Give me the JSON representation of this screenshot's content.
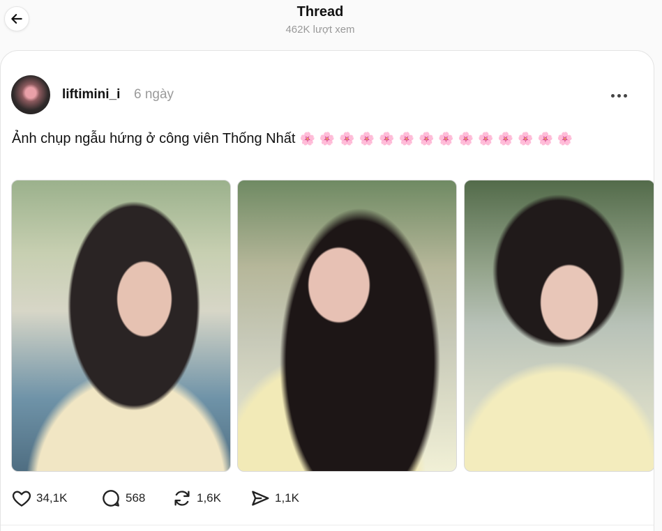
{
  "header": {
    "title": "Thread",
    "views": "462K lượt xem",
    "back_icon": "arrow-left-icon"
  },
  "post": {
    "username": "liftimini_i",
    "time": "6 ngày",
    "caption": "Ảnh chụp ngẫu hứng ở công viên Thống Nhất",
    "flower_count": 14,
    "flower_glyph": "🌸",
    "flower_color": "#f06f9a",
    "photos": [
      {
        "alt": "photo-1"
      },
      {
        "alt": "photo-2"
      },
      {
        "alt": "photo-3"
      }
    ],
    "actions": {
      "likes": "34,1K",
      "comments": "568",
      "reposts": "1,6K",
      "shares": "1,1K"
    }
  },
  "colors": {
    "background": "#fafafa",
    "card": "#ffffff",
    "muted_text": "#999999"
  }
}
